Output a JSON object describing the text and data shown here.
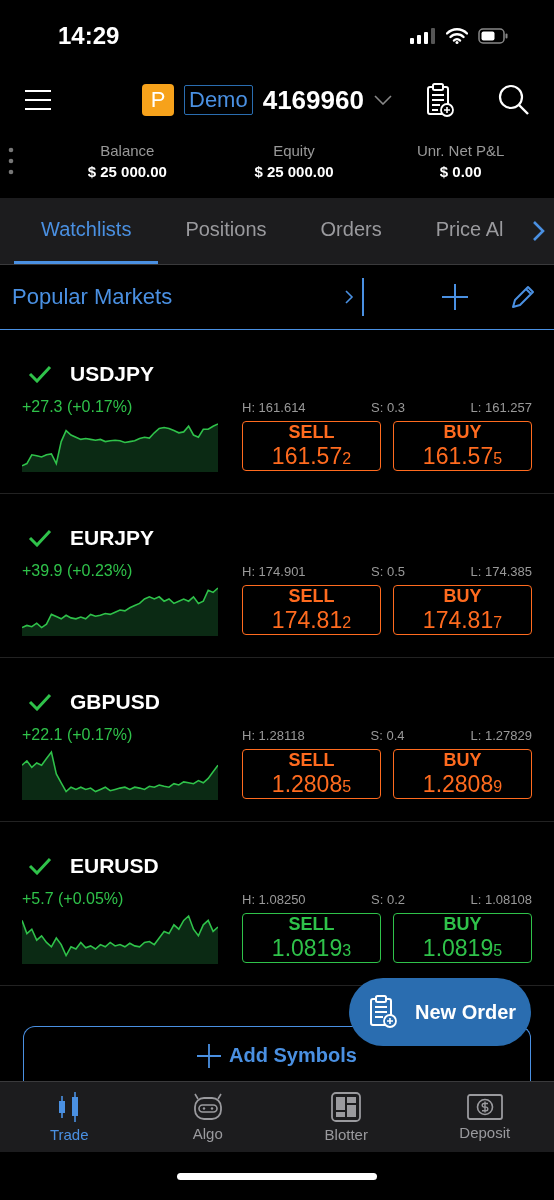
{
  "status_bar": {
    "time": "14:29"
  },
  "header": {
    "account_badge": "P",
    "account_type": "Demo",
    "account_number": "4169960"
  },
  "summary": [
    {
      "label": "Balance",
      "value": "$ 25 000.00"
    },
    {
      "label": "Equity",
      "value": "$ 25 000.00"
    },
    {
      "label": "Unr. Net P&L",
      "value": "$ 0.00"
    }
  ],
  "tabs": [
    {
      "label": "Watchlists",
      "selected": true
    },
    {
      "label": "Positions",
      "selected": false
    },
    {
      "label": "Orders",
      "selected": false
    },
    {
      "label": "Price Al",
      "selected": false
    }
  ],
  "watchlist": {
    "title": "Popular Markets"
  },
  "instruments": [
    {
      "symbol": "USDJPY",
      "change": "+27.3 (+0.17%)",
      "high": "H: 161.614",
      "spread": "S: 0.3",
      "low": "L: 161.257",
      "color": "#ff6b1f",
      "sell": {
        "label": "SELL",
        "price": "161.57",
        "pip": "2"
      },
      "buy": {
        "label": "BUY",
        "price": "161.57",
        "pip": "5"
      }
    },
    {
      "symbol": "EURJPY",
      "change": "+39.9 (+0.23%)",
      "high": "H: 174.901",
      "spread": "S: 0.5",
      "low": "L: 174.385",
      "color": "#ff6b1f",
      "sell": {
        "label": "SELL",
        "price": "174.81",
        "pip": "2"
      },
      "buy": {
        "label": "BUY",
        "price": "174.81",
        "pip": "7"
      }
    },
    {
      "symbol": "GBPUSD",
      "change": "+22.1 (+0.17%)",
      "high": "H: 1.28118",
      "spread": "S: 0.4",
      "low": "L: 1.27829",
      "color": "#ff6b1f",
      "sell": {
        "label": "SELL",
        "price": "1.2808",
        "pip": "5"
      },
      "buy": {
        "label": "BUY",
        "price": "1.2808",
        "pip": "9"
      }
    },
    {
      "symbol": "EURUSD",
      "change": "+5.7 (+0.05%)",
      "high": "H: 1.08250",
      "spread": "S: 0.2",
      "low": "L: 1.08108",
      "color": "#2fc24a",
      "sell": {
        "label": "SELL",
        "price": "1.0819",
        "pip": "3"
      },
      "buy": {
        "label": "BUY",
        "price": "1.0819",
        "pip": "5"
      }
    }
  ],
  "add_symbols": "Add Symbols",
  "new_order": "New Order",
  "bottom_nav": [
    {
      "label": "Trade",
      "selected": true
    },
    {
      "label": "Algo",
      "selected": false
    },
    {
      "label": "Blotter",
      "selected": false
    },
    {
      "label": "Deposit",
      "selected": false
    }
  ]
}
